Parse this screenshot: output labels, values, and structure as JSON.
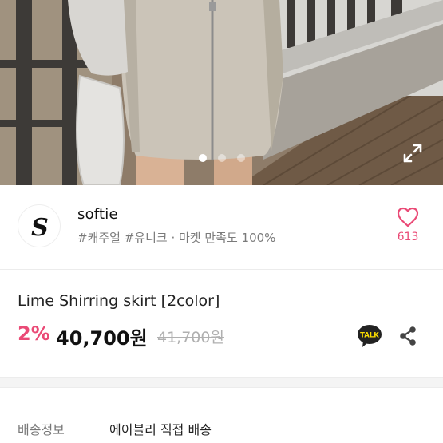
{
  "gallery": {
    "image_alt": "Lime Shirring skirt product photo",
    "dot_count": 3,
    "active_dot": 1,
    "expand_icon": "expand-arrows-icon"
  },
  "store": {
    "logo_letter": "S",
    "name": "softie",
    "tags": "#캐주얼 #유니크 · 마켓 만족도 100%",
    "like_count": "613",
    "like_icon": "heart-outline-icon"
  },
  "product": {
    "name": "Lime Shirring skirt [2color]",
    "discount": "2%",
    "price": "40,700원",
    "original_price": "41,700원",
    "talk_label": "TALK",
    "share_icon": "share-icon"
  },
  "shipping": {
    "label": "배송정보",
    "value": "에이블리 직접 배송"
  },
  "colors": {
    "accent_pink": "#ea4a76",
    "talk_bubble": "#222222",
    "talk_text": "#fadb00"
  }
}
